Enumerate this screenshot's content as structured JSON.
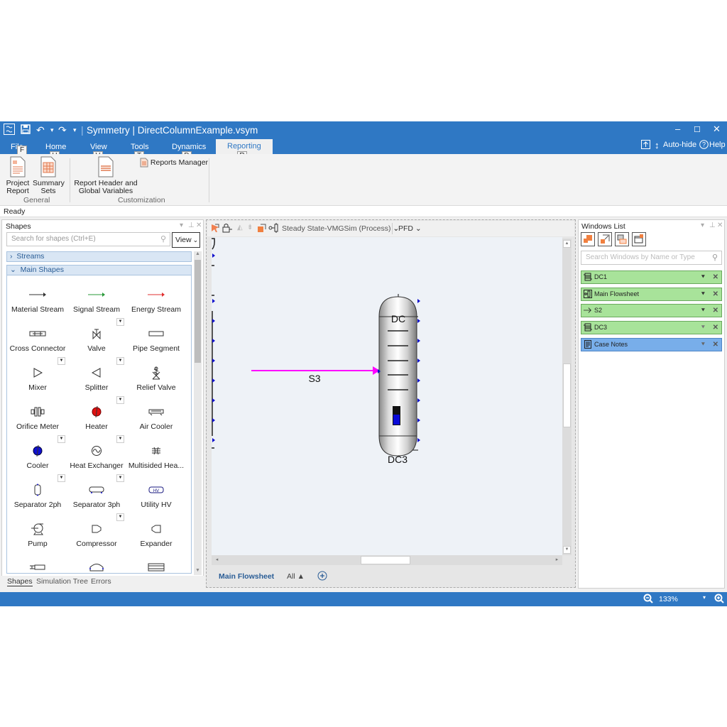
{
  "window": {
    "title": "Symmetry | DirectColumnExample.vsym",
    "controls": {
      "minimize": "–",
      "maximize": "☐",
      "close": "✕"
    }
  },
  "quick_access": {
    "app_icon": "app-logo-icon",
    "save": "save-icon",
    "undo": "undo-icon",
    "redo": "redo-icon",
    "dropdown_arrow": "▾"
  },
  "ribbon_tabs": [
    {
      "label": "File",
      "keytip": "F"
    },
    {
      "label": "Home",
      "keytip": "H"
    },
    {
      "label": "View",
      "keytip": "V"
    },
    {
      "label": "Tools",
      "keytip": "T"
    },
    {
      "label": "Dynamics",
      "keytip": "D"
    },
    {
      "label": "Reporting",
      "keytip": "R",
      "active": true
    }
  ],
  "ribbon_right": {
    "auto_hide": "Auto-hide",
    "help": "Help"
  },
  "ribbon": {
    "groups": [
      {
        "label": "General",
        "buttons": [
          {
            "label_line1": "Project",
            "label_line2": "Report"
          },
          {
            "label_line1": "Summary",
            "label_line2": "Sets"
          }
        ]
      },
      {
        "label": "Customization",
        "buttons": [
          {
            "label_line1": "Report Header and",
            "label_line2": "Global Variables"
          },
          {
            "label_line1": "Reports Manager",
            "label_line2": ""
          }
        ]
      }
    ]
  },
  "status": {
    "text": "Ready"
  },
  "shapes_panel": {
    "title": "Shapes",
    "search_placeholder": "Search for shapes (Ctrl+E)",
    "view_button": "View",
    "categories": [
      {
        "label": "Streams",
        "expanded": false
      },
      {
        "label": "Main Shapes",
        "expanded": true
      }
    ],
    "items": [
      {
        "label": "Material Stream"
      },
      {
        "label": "Signal Stream"
      },
      {
        "label": "Energy Stream"
      },
      {
        "label": "Cross Connector"
      },
      {
        "label": "Valve"
      },
      {
        "label": "Pipe Segment"
      },
      {
        "label": "Mixer"
      },
      {
        "label": "Splitter"
      },
      {
        "label": "Relief Valve"
      },
      {
        "label": "Orifice Meter"
      },
      {
        "label": "Heater"
      },
      {
        "label": "Air Cooler"
      },
      {
        "label": "Cooler"
      },
      {
        "label": "Heat Exchanger"
      },
      {
        "label": "Multisided Hea..."
      },
      {
        "label": "Separator 2ph"
      },
      {
        "label": "Separator 3ph"
      },
      {
        "label": "Utility HV"
      },
      {
        "label": "Pump"
      },
      {
        "label": "Compressor"
      },
      {
        "label": "Expander"
      }
    ],
    "bottom_tabs": [
      {
        "label": "Shapes",
        "active": true
      },
      {
        "label": "Simulation Tree"
      },
      {
        "label": "Errors"
      }
    ]
  },
  "flowsheet": {
    "toolbar": {
      "mode_select": "Steady State-VMGSim (Process)",
      "view_select": "PFD"
    },
    "column_label_top": "DC",
    "column_name": "DC3",
    "stream_name": "S3",
    "colors": {
      "stream": "#ff00ff",
      "port": "#1010cc",
      "level": "#0a0ad8"
    },
    "bottom_tabs": [
      {
        "label": "Main Flowsheet",
        "active": true
      },
      {
        "label": "All ▲"
      }
    ]
  },
  "windows_list": {
    "title": "Windows List",
    "search_placeholder": "Search Windows by Name or Type",
    "items": [
      {
        "label": "DC1",
        "icon": "column-icon",
        "color": "green"
      },
      {
        "label": "Main Flowsheet",
        "icon": "flowsheet-icon",
        "color": "green"
      },
      {
        "label": "S2",
        "icon": "stream-arrow-icon",
        "color": "green"
      },
      {
        "label": "DC3",
        "icon": "column-icon",
        "color": "green"
      },
      {
        "label": "Case Notes",
        "icon": "notes-icon",
        "color": "blue"
      }
    ]
  },
  "zoom": {
    "level": "133%"
  }
}
